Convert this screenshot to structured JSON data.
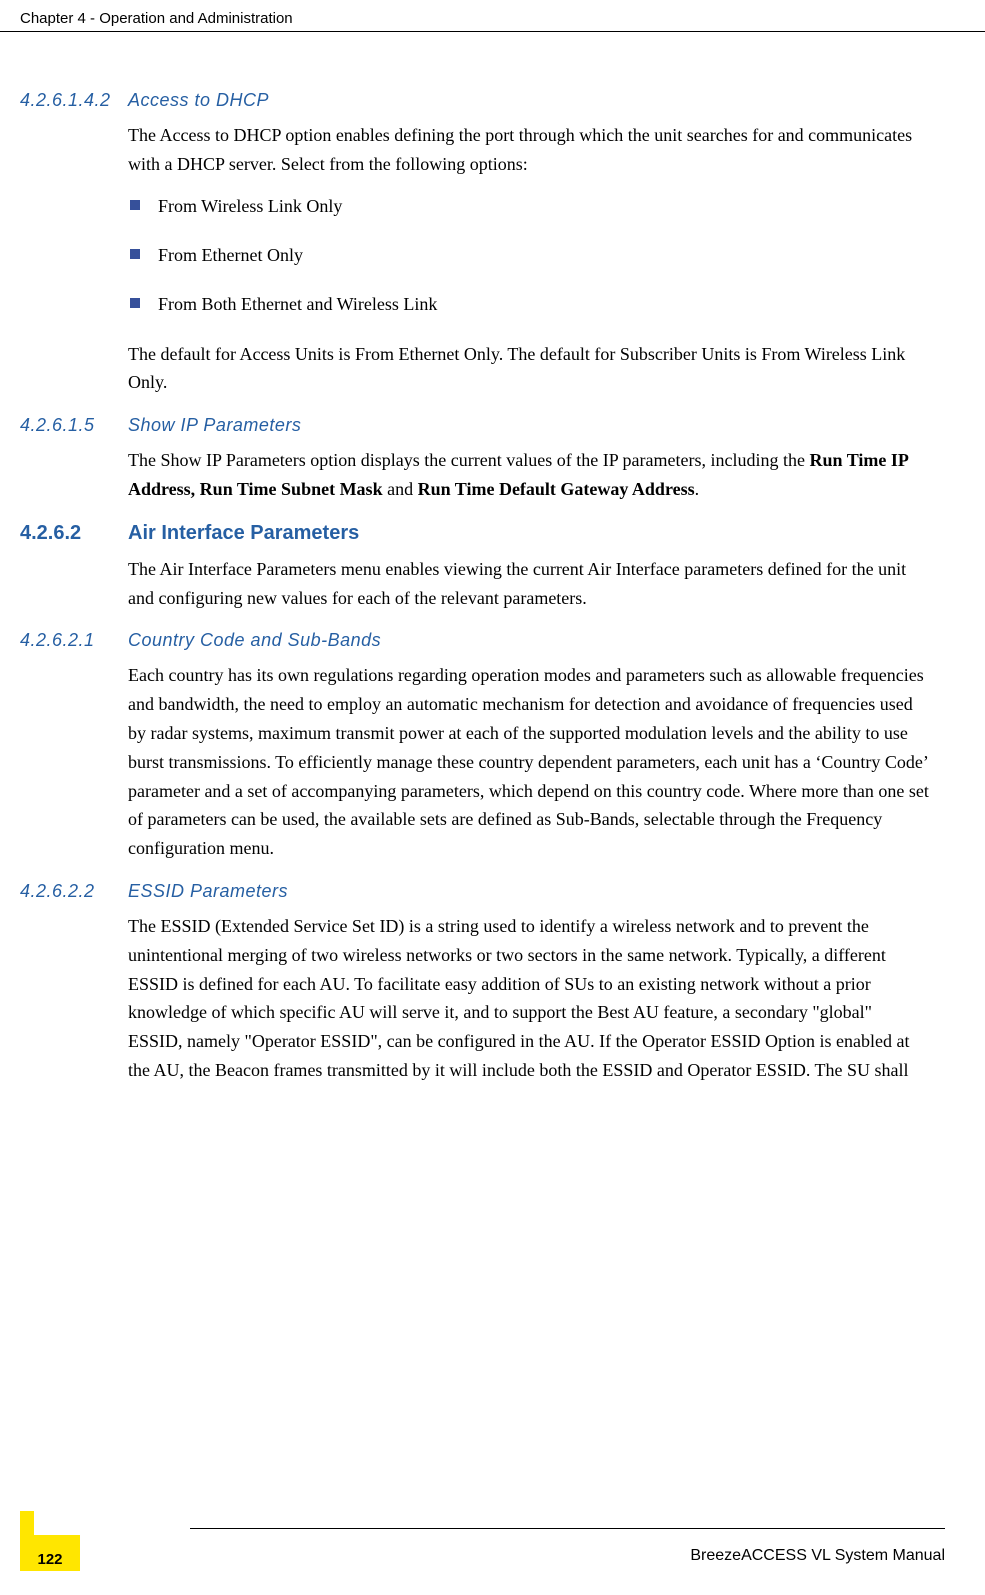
{
  "header": "Chapter 4 - Operation and Administration",
  "s1": {
    "num": "4.2.6.1.4.2",
    "title": "Access to DHCP",
    "p1": "The Access to DHCP option enables defining the port through which the unit searches for and communicates with a DHCP server. Select from the following options:",
    "li1": "From Wireless Link Only",
    "li2": "From Ethernet Only",
    "li3": "From Both Ethernet and Wireless Link",
    "p2": "The default for Access Units is From Ethernet Only. The default for Subscriber Units is From Wireless Link Only."
  },
  "s2": {
    "num": "4.2.6.1.5",
    "title": "Show IP Parameters",
    "p1a": "The Show IP Parameters option displays the current values of the IP parameters, including the ",
    "p1b": "Run Time IP Address, Run Time Subnet Mask",
    "p1c": " and ",
    "p1d": "Run Time Default Gateway Address",
    "p1e": "."
  },
  "s3": {
    "num": "4.2.6.2",
    "title": "Air Interface Parameters",
    "p1": "The Air Interface Parameters menu enables viewing the current Air Interface parameters defined for the unit and configuring new values for each of the relevant parameters."
  },
  "s4": {
    "num": "4.2.6.2.1",
    "title": "Country Code and Sub-Bands",
    "p1": "Each country has its own regulations regarding operation modes and parameters such as allowable frequencies and bandwidth, the need to employ an automatic mechanism for detection and avoidance of frequencies used by radar systems, maximum transmit power at each of the supported modulation levels and the ability to use burst transmissions. To efficiently manage these country dependent parameters, each unit has a ‘Country Code’ parameter and a set of accompanying parameters, which depend on this country code. Where more than one set of parameters can be used, the available sets are defined as Sub-Bands, selectable through the Frequency configuration menu."
  },
  "s5": {
    "num": "4.2.6.2.2",
    "title": "ESSID Parameters",
    "p1": "The ESSID (Extended Service Set ID) is a string used to identify a wireless network and to prevent the unintentional merging of two wireless networks or two sectors in the same network. Typically, a different ESSID is defined for each AU. To facilitate easy addition of SUs to an existing network without a prior knowledge of which specific AU will serve it, and to support the Best AU feature, a secondary \"global\" ESSID, namely \"Operator ESSID\", can be configured in the AU. If the Operator ESSID Option is enabled at the AU, the Beacon frames transmitted by it will include both the ESSID and Operator ESSID. The SU shall"
  },
  "footer": {
    "page": "122",
    "doc": "BreezeACCESS VL System Manual"
  }
}
